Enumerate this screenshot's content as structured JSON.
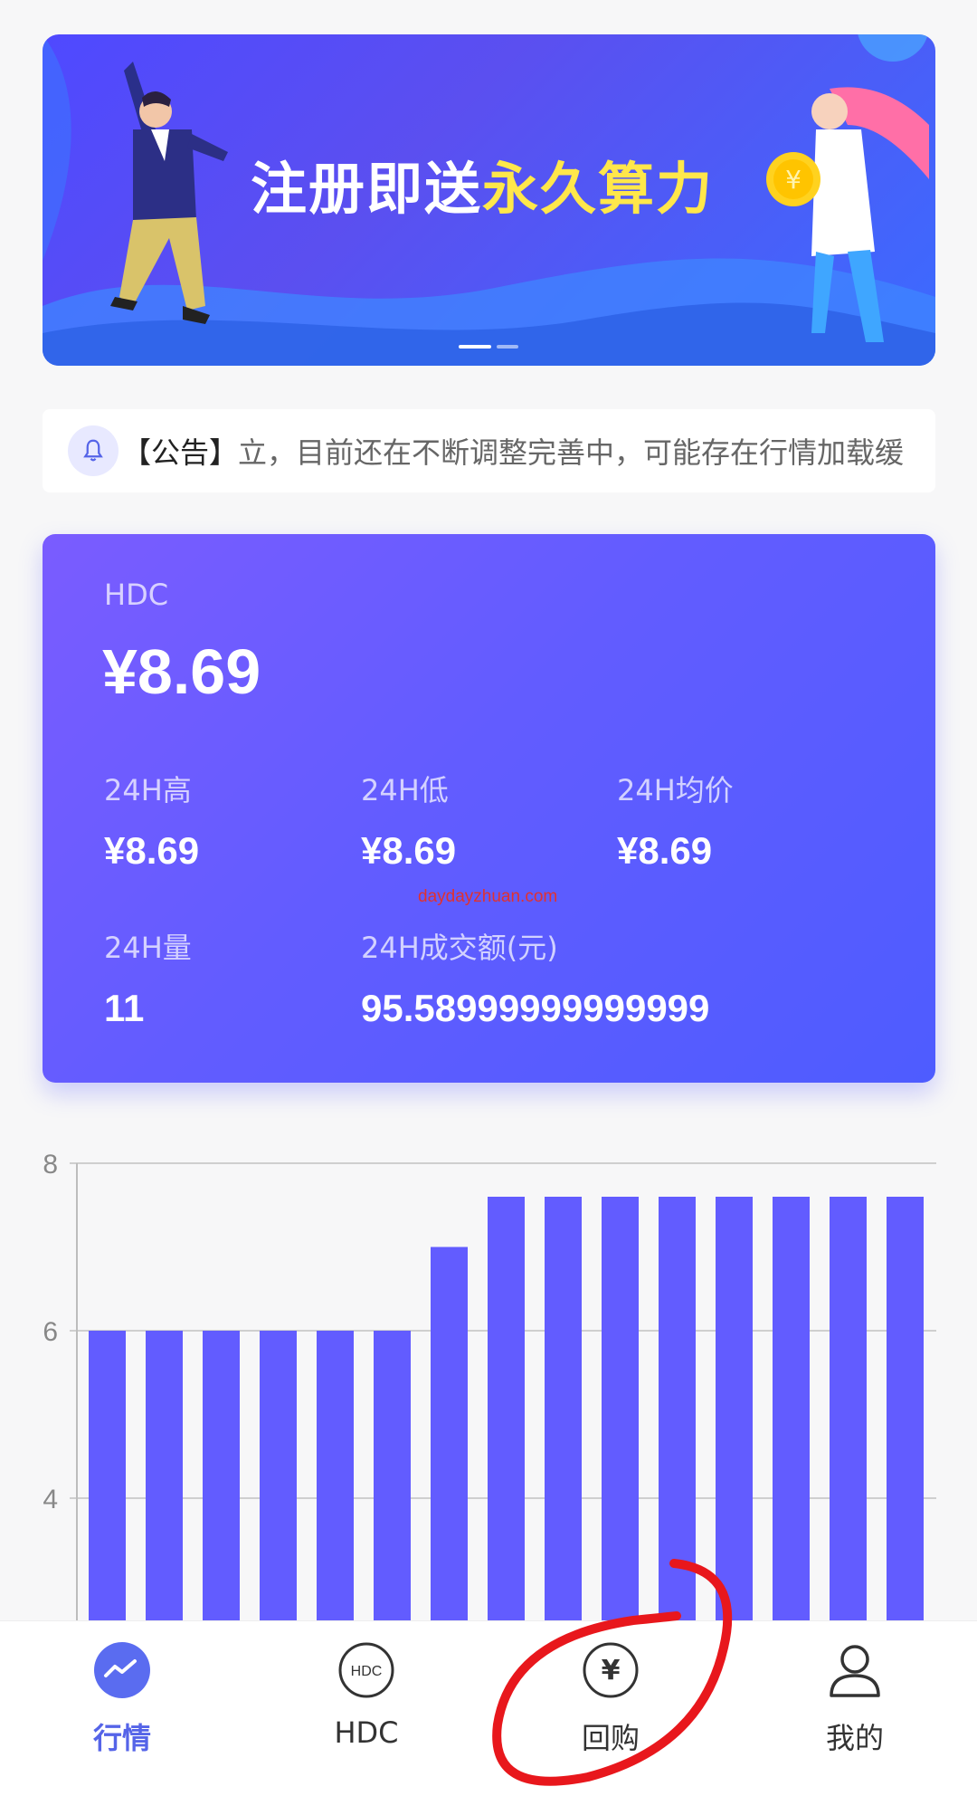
{
  "banner": {
    "title_plain": "注册即送",
    "title_highlight": "永久算力",
    "coin_symbol": "¥",
    "slide_count": 2,
    "active_slide": 1
  },
  "notice": {
    "tag": "【公告】",
    "text": "立，目前还在不断调整完善中，可能存在行情加载缓"
  },
  "price_card": {
    "symbol": "HDC",
    "price": "¥8.69",
    "stats": [
      {
        "label": "24H高",
        "value": "¥8.69"
      },
      {
        "label": "24H低",
        "value": "¥8.69"
      },
      {
        "label": "24H均价",
        "value": "¥8.69"
      },
      {
        "label": "24H量",
        "value": "11"
      },
      {
        "label": "24H成交额(元)",
        "value": "95.58999999999999"
      }
    ],
    "watermark": "daydayzhuan.com"
  },
  "chart_data": {
    "type": "bar",
    "values": [
      6,
      6,
      6,
      6,
      6,
      6,
      7,
      7.6,
      7.6,
      7.6,
      7.6,
      7.6,
      7.6,
      7.6,
      7.6
    ],
    "ylim": [
      0,
      8
    ],
    "yticks": [
      "2",
      "4",
      "6",
      "8"
    ],
    "grid": true,
    "color": "#625cff"
  },
  "nav": {
    "items": [
      {
        "label": "行情",
        "icon": "trend-icon",
        "active": true
      },
      {
        "label": "HDC",
        "icon": "hdc-coin-icon",
        "active": false
      },
      {
        "label": "回购",
        "icon": "yen-coin-icon",
        "active": false
      },
      {
        "label": "我的",
        "icon": "user-icon",
        "active": false
      }
    ],
    "active_color": "#5564e8",
    "hdc_icon_text": "HDC",
    "yen_icon_text": "¥"
  }
}
